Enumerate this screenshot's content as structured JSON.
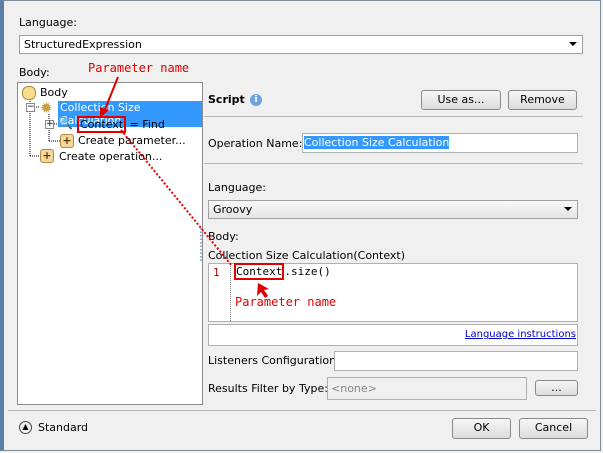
{
  "language_label": "Language:",
  "language_value": "StructuredExpression",
  "body_label": "Body:",
  "tree": {
    "root": "Body",
    "operation": "Collection Size Calculation",
    "parameter_name": "Context",
    "parameter_rest": " = Find",
    "create_parameter": "Create parameter...",
    "create_operation": "Create operation..."
  },
  "script": {
    "title": "Script",
    "use_as": "Use as...",
    "remove": "Remove",
    "operation_name_label": "Operation Name:",
    "operation_name_value": "Collection Size Calculation",
    "language_label": "Language:",
    "language_value": "Groovy",
    "body_label": "Body:",
    "signature": "Collection Size Calculation(Context)",
    "line_number": "1",
    "code_param": "Context",
    "code_rest": ".size()",
    "language_instructions": "Language instructions",
    "listeners_label": "Listeners Configuration:",
    "listeners_value": "",
    "results_filter_label": "Results Filter by Type:",
    "results_filter_value": "<none>",
    "browse": "..."
  },
  "annotations": {
    "top": "Parameter name",
    "bottom": "Parameter name"
  },
  "footer": {
    "standard": "Standard",
    "ok": "OK",
    "cancel": "Cancel"
  }
}
